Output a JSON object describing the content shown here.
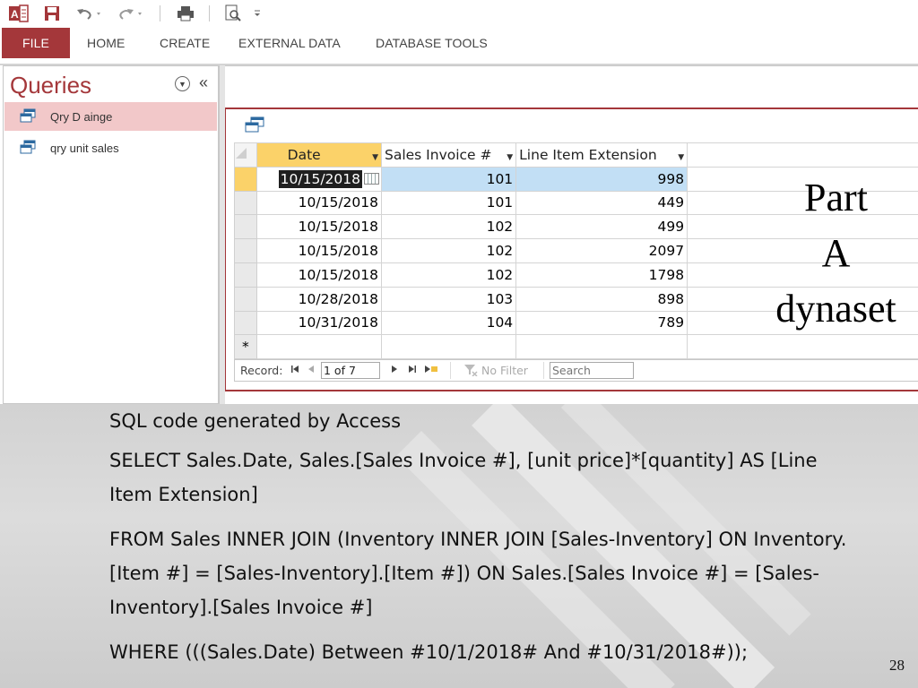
{
  "ribbon": {
    "tabs": [
      "FILE",
      "HOME",
      "CREATE",
      "EXTERNAL DATA",
      "DATABASE TOOLS"
    ]
  },
  "nav_pane": {
    "title": "Queries",
    "items": [
      {
        "label": "Qry D ainge",
        "selected": true
      },
      {
        "label": "qry unit sales",
        "selected": false
      }
    ]
  },
  "datasheet": {
    "columns": [
      "Date",
      "Sales Invoice #",
      "Line Item Extension"
    ],
    "rows": [
      {
        "date": "10/15/2018",
        "invoice": "101",
        "extension": "998"
      },
      {
        "date": "10/15/2018",
        "invoice": "101",
        "extension": "449"
      },
      {
        "date": "10/15/2018",
        "invoice": "102",
        "extension": "499"
      },
      {
        "date": "10/15/2018",
        "invoice": "102",
        "extension": "2097"
      },
      {
        "date": "10/15/2018",
        "invoice": "102",
        "extension": "1798"
      },
      {
        "date": "10/28/2018",
        "invoice": "103",
        "extension": "898"
      },
      {
        "date": "10/31/2018",
        "invoice": "104",
        "extension": "789"
      }
    ],
    "new_row_marker": "*"
  },
  "record_nav": {
    "label": "Record:",
    "position": "1 of 7",
    "filter_label": "No Filter",
    "search_placeholder": "Search"
  },
  "overlay": {
    "line1": "Part",
    "line2": "A",
    "line3": "dynaset"
  },
  "slide": {
    "heading": "SQL code generated by Access",
    "select": "SELECT Sales.Date, Sales.[Sales Invoice #], [unit price]*[quantity] AS [Line Item Extension]",
    "from": "FROM Sales INNER JOIN (Inventory INNER JOIN [Sales-Inventory] ON Inventory.[Item #] = [Sales-Inventory].[Item #]) ON Sales.[Sales Invoice #] = [Sales-Inventory].[Sales Invoice #]",
    "where": "WHERE (((Sales.Date) Between #10/1/2018# And #10/31/2018#));",
    "page_number": "28"
  },
  "colors": {
    "access_accent": "#a4373a",
    "selected_header": "#fbd269",
    "selected_row": "#c2dff5",
    "nav_selected": "#f2c8c9"
  }
}
